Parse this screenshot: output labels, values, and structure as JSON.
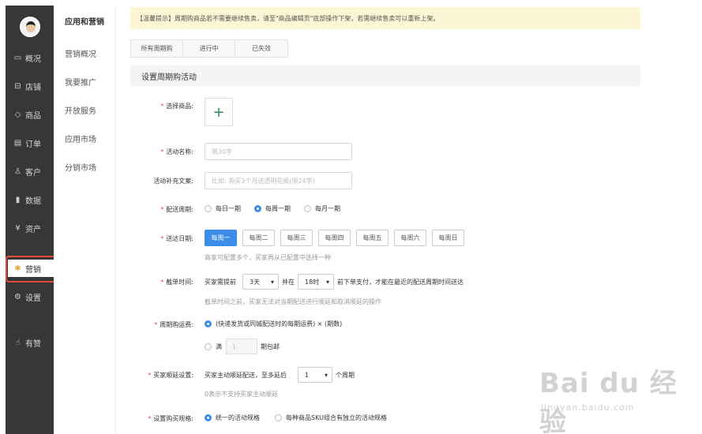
{
  "sidebar": {
    "items": [
      {
        "icon": "▭",
        "icon_name": "overview-icon",
        "label": "概况"
      },
      {
        "icon": "⊟",
        "icon_name": "store-icon",
        "label": "店铺"
      },
      {
        "icon": "◇",
        "icon_name": "goods-icon",
        "label": "商品"
      },
      {
        "icon": "▤",
        "icon_name": "order-icon",
        "label": "订单"
      },
      {
        "icon": "♙",
        "icon_name": "customer-icon",
        "label": "客户"
      },
      {
        "icon": "▮",
        "icon_name": "data-icon",
        "label": "数据"
      },
      {
        "icon": "¥",
        "icon_name": "asset-icon",
        "label": "资产"
      },
      {
        "icon": "✱",
        "icon_name": "marketing-icon",
        "label": "营销"
      },
      {
        "icon": "⚙",
        "icon_name": "settings-icon",
        "label": "设置"
      },
      {
        "icon": "☝",
        "icon_name": "like-icon",
        "label": "有赞"
      }
    ]
  },
  "subnav": {
    "title": "应用和营销",
    "items": [
      "营销概况",
      "我要推广",
      "开放服务",
      "应用市场",
      "分销市场"
    ]
  },
  "notice": "【温馨提示】周期购商品若不需要继续售卖，请至\"商品编辑页\"底部操作下架，若需继续售卖可以重新上架。",
  "tabs": [
    "所有周期购",
    "进行中",
    "已失效"
  ],
  "section_title": "设置周期购活动",
  "form": {
    "choose_goods_label": "选择商品:",
    "add_symbol": "+",
    "name_label": "活动名称:",
    "name_placeholder": "限30字",
    "extra_label": "活动补充文案:",
    "extra_placeholder": "比如: 购买3个月送透明花瓶(限24字)",
    "cycle_label": "配送周期:",
    "cycle_options": [
      "每日一期",
      "每周一期",
      "每月一期"
    ],
    "cycle_selected": 1,
    "delivery_label": "送达日期:",
    "weekdays": [
      "每周一",
      "每周二",
      "每周三",
      "每周四",
      "每周五",
      "每周六",
      "每周日"
    ],
    "weekday_selected": 0,
    "delivery_hint": "商家可配置多个，买家再从已配置中选择一种",
    "cutoff_label": "截单时间:",
    "cutoff_prefix": "买家需提前",
    "cutoff_days": "3天",
    "cutoff_and": "并在",
    "cutoff_hour": "18时",
    "cutoff_suffix": "前下单支付，才能在最近的配送周期时间送达",
    "cutoff_hint": "截单时间之前，买家无法对当期配送进行顺延和取消顺延的操作",
    "freight_label": "周期购运费:",
    "freight_option1": "(快递发货或同城配送时的每期运费) × (期数)",
    "freight_option2_prefix": "满",
    "freight_value": "1",
    "freight_option2_suffix": "期包邮",
    "delay_label": "买家顺延设置:",
    "delay_prefix": "买家主动顺延配送，至多延后",
    "delay_value": "1",
    "delay_suffix": "个周期",
    "delay_hint": "0表示不支持买家主动顺延",
    "spec_label": "设置购买规格:",
    "spec_options": [
      "统一的活动规格",
      "每种商品SKU组合有独立的活动规格"
    ],
    "required_mark": "*"
  },
  "watermark": {
    "main": "Bai du 经验",
    "sub": "jingyan.baidu.com"
  }
}
